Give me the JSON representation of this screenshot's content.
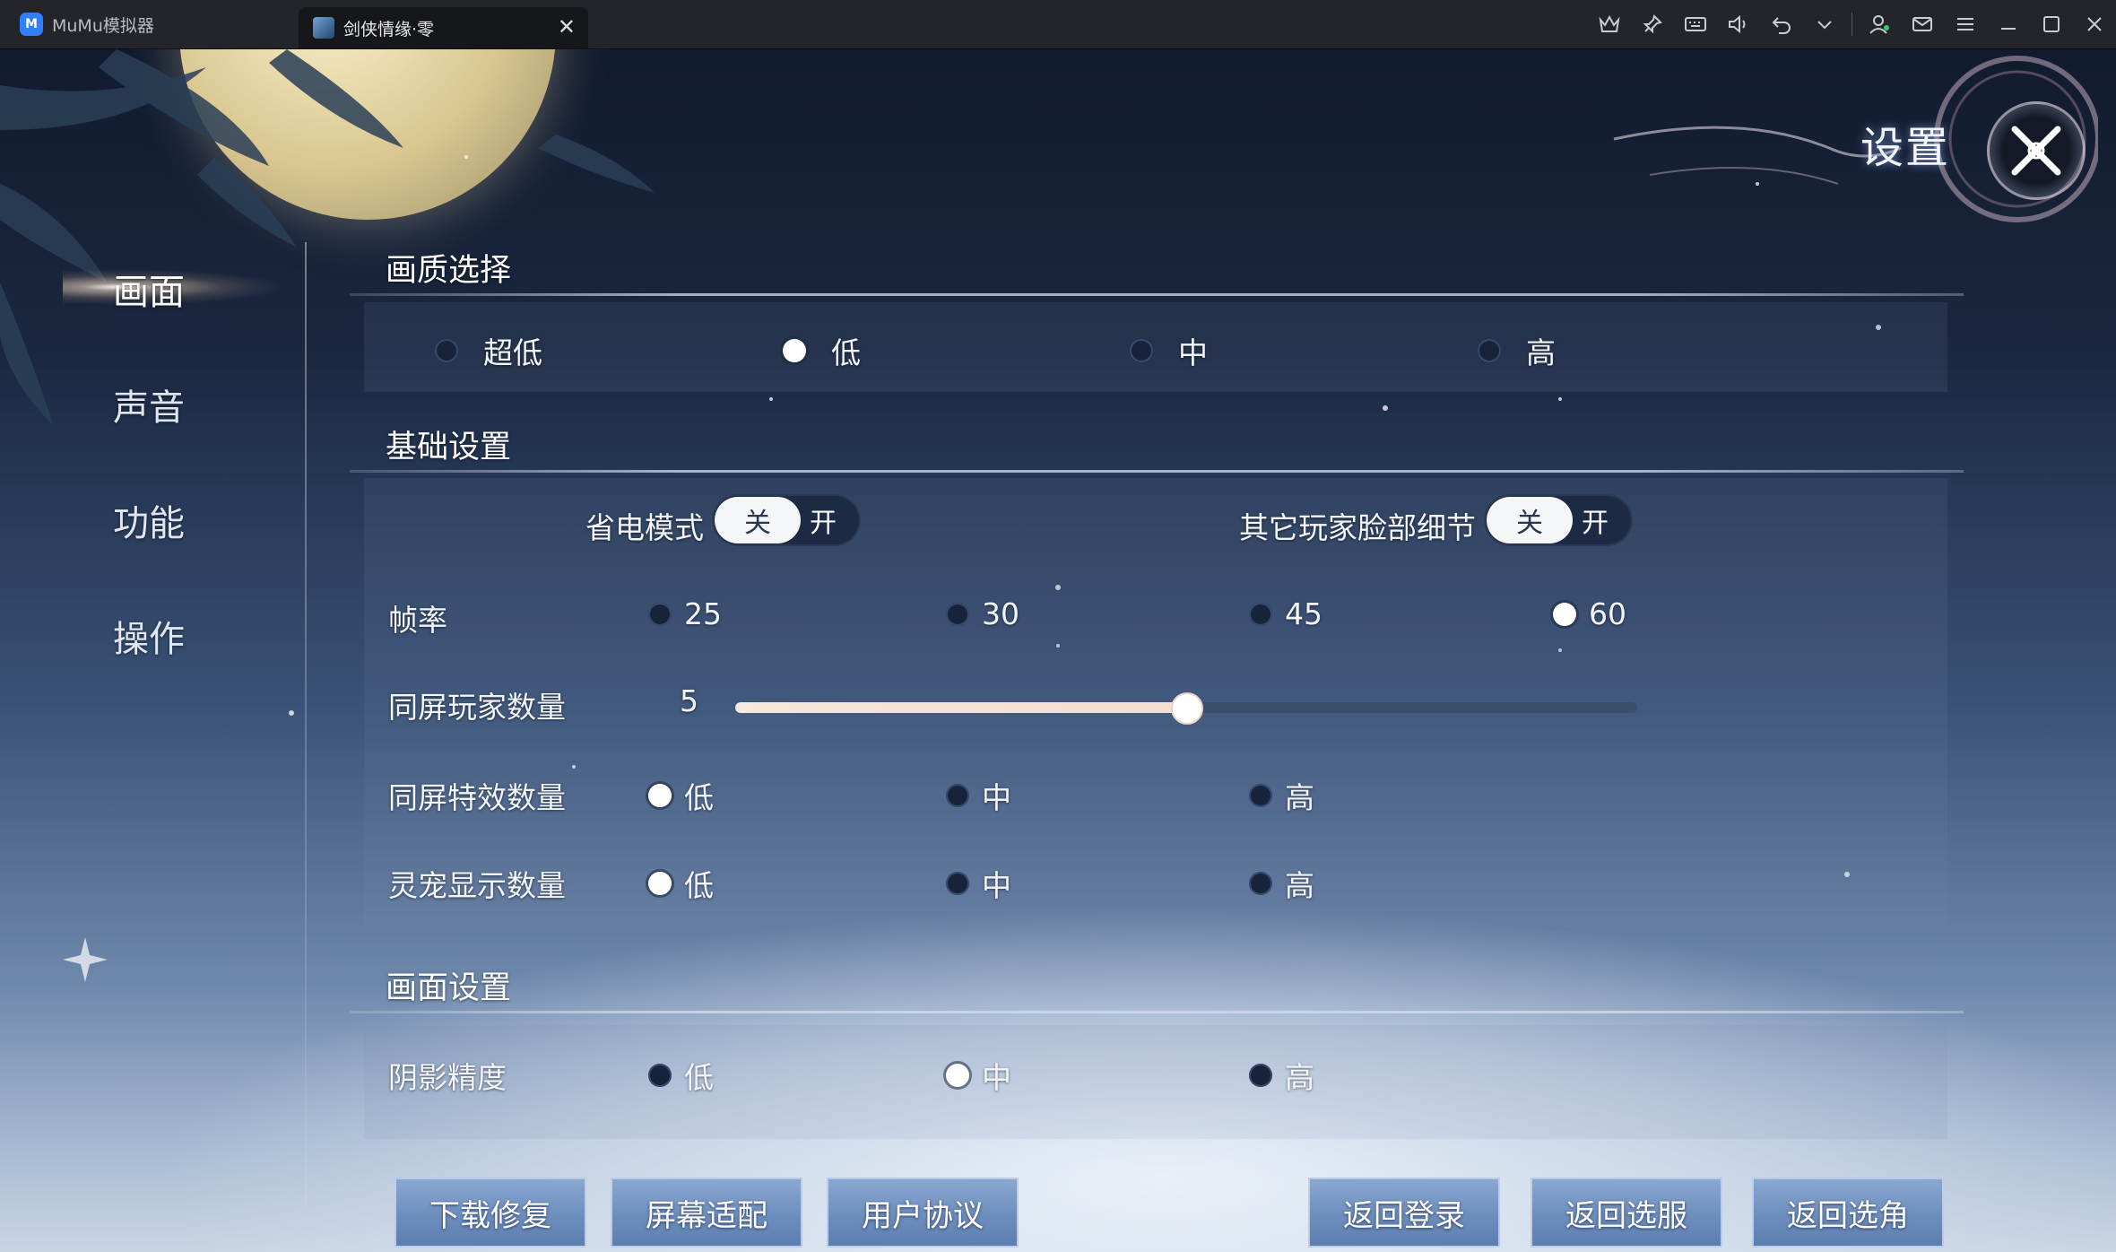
{
  "titlebar": {
    "app_logo": "M",
    "app_name": "MuMu模拟器",
    "tab_title": "剑侠情缘·零",
    "tab_close": "✕",
    "icons": [
      "crown-icon",
      "pin-icon",
      "keyboard-icon",
      "volume-icon",
      "undo-icon",
      "chevron-down-icon",
      "user-icon",
      "mail-icon",
      "menu-icon",
      "minimize-icon",
      "maximize-icon",
      "close-icon"
    ]
  },
  "header": {
    "title": "设置"
  },
  "nav": {
    "items": [
      {
        "label": "画面",
        "active": true
      },
      {
        "label": "声音",
        "active": false
      },
      {
        "label": "功能",
        "active": false
      },
      {
        "label": "操作",
        "active": false
      }
    ]
  },
  "quality": {
    "title": "画质选择",
    "options": [
      "超低",
      "低",
      "中",
      "高"
    ],
    "selected": "低"
  },
  "basic": {
    "title": "基础设置",
    "power_saving": {
      "label": "省电模式",
      "knob": "关",
      "other": "开",
      "state": "关"
    },
    "face_detail": {
      "label": "其它玩家脸部细节",
      "knob": "关",
      "other": "开",
      "state": "关"
    },
    "fps": {
      "label": "帧率",
      "options": [
        "25",
        "30",
        "45",
        "60"
      ],
      "selected": "60"
    },
    "players": {
      "label": "同屏玩家数量",
      "value": "5",
      "fraction": 0.5
    },
    "effects": {
      "label": "同屏特效数量",
      "options": [
        "低",
        "中",
        "高"
      ],
      "selected": "低"
    },
    "pets": {
      "label": "灵宠显示数量",
      "options": [
        "低",
        "中",
        "高"
      ],
      "selected": "低"
    }
  },
  "display": {
    "title": "画面设置",
    "shadow": {
      "label": "阴影精度",
      "options": [
        "低",
        "中",
        "高"
      ],
      "selected": "中"
    }
  },
  "buttons": {
    "download_repair": "下载修复",
    "screen_fit": "屏幕适配",
    "user_agreement": "用户协议",
    "back_login": "返回登录",
    "back_server": "返回选服",
    "back_character": "返回选角"
  }
}
